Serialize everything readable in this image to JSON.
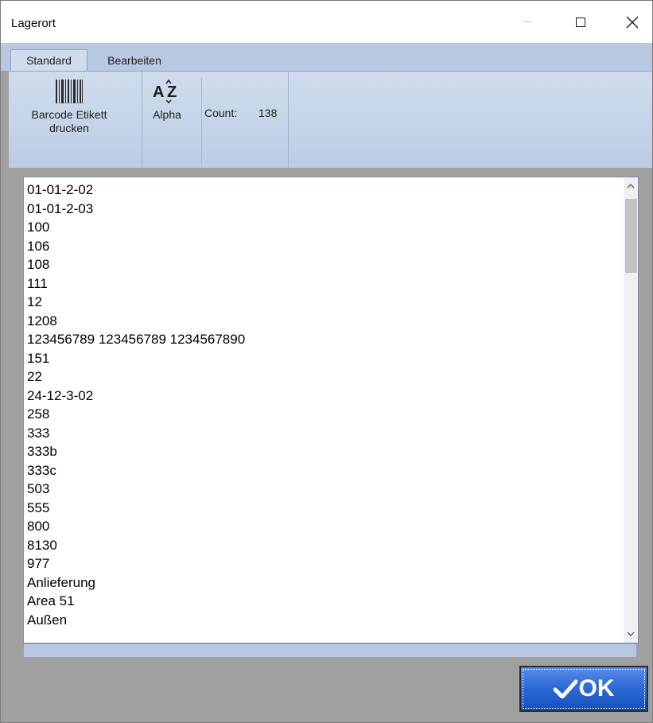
{
  "window": {
    "title": "Lagerort",
    "minimize_icon": "minimize-icon",
    "maximize_icon": "maximize-icon",
    "close_icon": "close-icon"
  },
  "ribbon": {
    "tabs": [
      {
        "label": "Standard",
        "active": true
      },
      {
        "label": "Bearbeiten",
        "active": false
      }
    ],
    "groups": {
      "barcode": {
        "label_line1": "Barcode Etikett",
        "label_line2": "drucken",
        "icon": "barcode-icon"
      },
      "alpha": {
        "label": "Alpha",
        "icon": "sort-alpha-icon",
        "count_label": "Count:",
        "count_value": "138"
      }
    }
  },
  "list": {
    "items": [
      "01-01-2-02",
      "01-01-2-03",
      "100",
      "106",
      "108",
      "111",
      "12",
      "1208",
      "123456789 123456789 1234567890",
      "151",
      "22",
      "24-12-3-02",
      "258",
      "333",
      "333b",
      "333c",
      "503",
      "555",
      "800",
      "8130",
      "977",
      "Anlieferung",
      "Area 51",
      "Außen"
    ],
    "scroll_up_icon": "chevron-up-icon",
    "scroll_down_icon": "chevron-down-icon"
  },
  "footer": {
    "ok_label": "OK",
    "ok_icon": "checkmark-icon"
  },
  "colors": {
    "ribbon": "#cfdcee",
    "ok_button": "#2f6bd8",
    "client_bg": "#a0a0a0"
  }
}
